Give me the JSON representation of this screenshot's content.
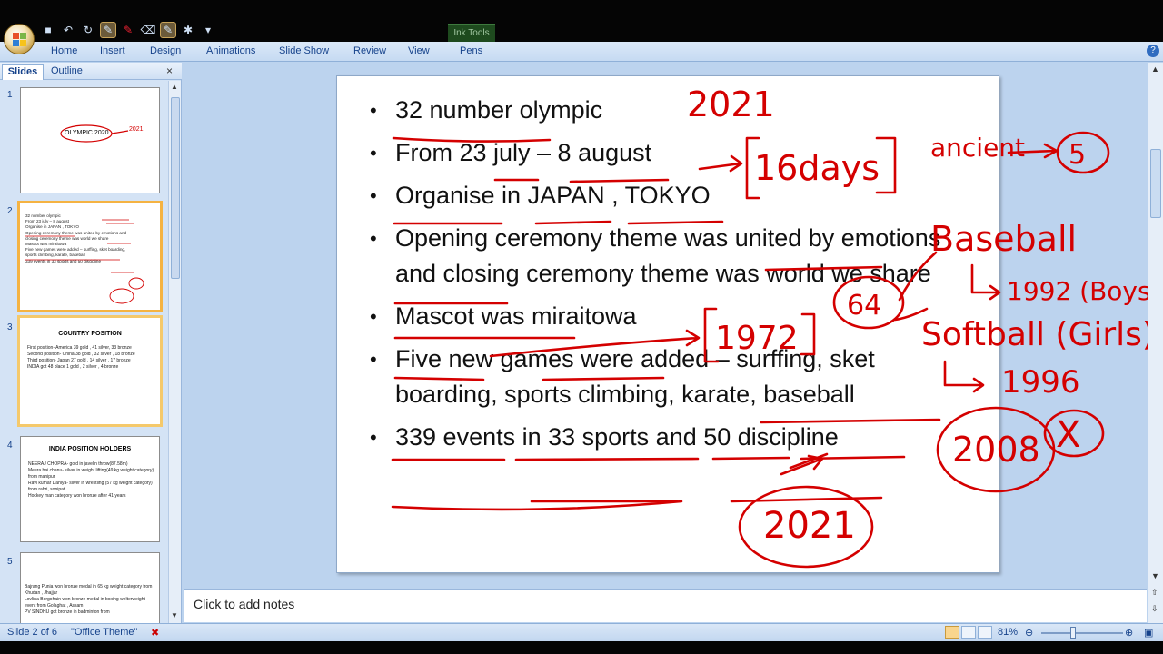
{
  "ribbon": {
    "contextual_tab": "Ink Tools",
    "tabs": [
      "Home",
      "Insert",
      "Design",
      "Animations",
      "Slide Show",
      "Review",
      "View",
      "Pens"
    ]
  },
  "panel": {
    "tab_slides": "Slides",
    "tab_outline": "Outline",
    "close": "×",
    "slide_numbers": [
      "1",
      "2",
      "3",
      "4",
      "5"
    ],
    "thumb1": {
      "title": "OLYMPIC 2020",
      "note": "2021"
    },
    "thumb2": {
      "lines": [
        "32 number olympic",
        "From 23 july – 8 august",
        "Organise in JAPAN , TOKYO",
        "Opening ceremony theme was united by emotions and closing ceremony theme was world we share",
        "Mascot was miraitowa",
        "Five new games were added – surffing, sket boarding, sports climbing, karate, baseball",
        "339 events in 33 sports and 50 discipline"
      ]
    },
    "thumb3": {
      "title": "COUNTRY POSITION",
      "lines": [
        "First position- America 39 gold , 41 silver, 33 bronze",
        "Second position- China 38 gold , 32 silver , 18 bronze",
        "Third position- Japan 27 gold , 14 silver , 17 bronze",
        "INDIA got 48 place 1 gold , 2 silver , 4 bronze"
      ]
    },
    "thumb4": {
      "title": "INDIA POSITION HOLDERS",
      "lines": [
        "NEERAJ CHOPRA- gold in javelin throw(87.58m)",
        "Meera bai chanu- silver in weight lifting(49 kg weight category) from manipur",
        "Ravi kumar Dahiya- silver in wrestling (57 kg weight category) from rahri, sonipat",
        "Hockey man category won bronze after 41 years"
      ]
    },
    "thumb5": {
      "lines": [
        "Bajrang Punia won bronze medal in 65 kg weight category from Khudan , Jhajjar",
        "Lovlina Borgohain won bronze medal in boxing welterweight event from Golaghat , Assam",
        "PV SINDHU got bronze in badminton from"
      ]
    }
  },
  "slide": {
    "bullets": [
      "32 number olympic",
      "From 23 july – 8 august",
      "Organise in JAPAN , TOKYO",
      "Opening ceremony theme was united by emotions and closing ceremony theme was world we share",
      "Mascot was miraitowa",
      "Five new games were added – surffing, sket boarding, sports climbing, karate, baseball",
      "339 events in 33 sports and 50 discipline"
    ],
    "handwriting": {
      "top_year": "2021",
      "days": "16days",
      "ancient": "ancient",
      "ancient_count": "5",
      "baseball": "Baseball",
      "baseball_year": "1992 (Boys)",
      "circle_num": "64",
      "softball": "Softball (Girls)",
      "softball_year": "1996",
      "year_1972": "1972",
      "year_2008": "2008",
      "cross": "X",
      "bottom_year": "2021"
    }
  },
  "notes": {
    "placeholder": "Click to add notes"
  },
  "status": {
    "slide_info": "Slide 2 of 6",
    "theme": "\"Office Theme\"",
    "zoom": "81%",
    "zoom_level_percent": 81
  },
  "colors": {
    "ink": "#d40000",
    "selection": "#f5b342",
    "ribbon_text": "#15428b"
  }
}
